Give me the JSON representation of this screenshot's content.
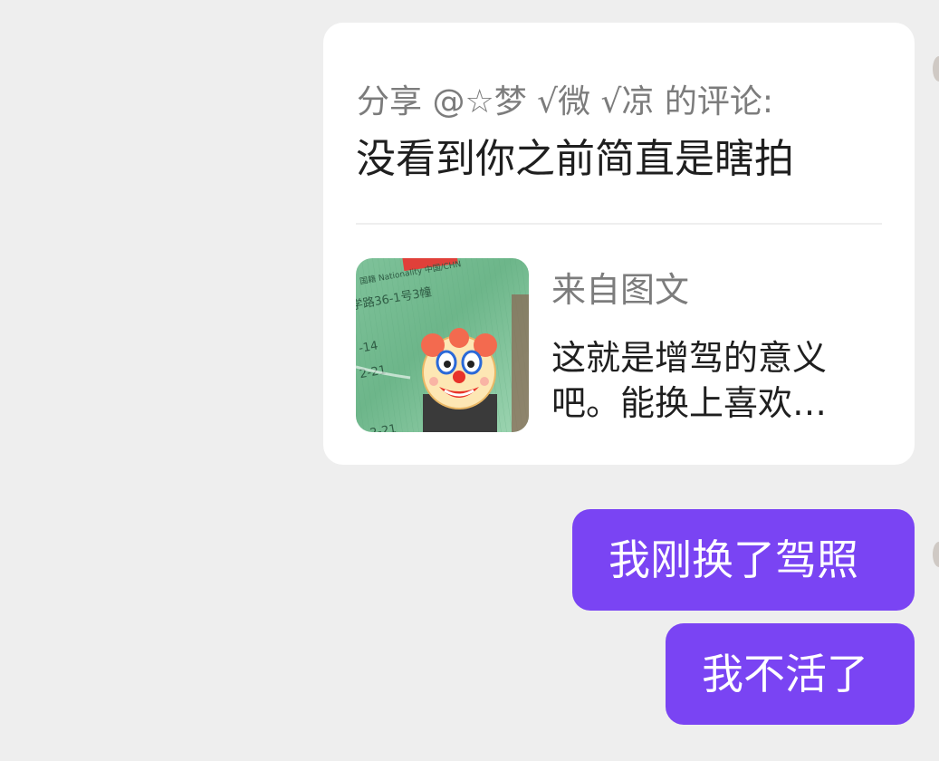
{
  "share_card": {
    "header": "分享 @☆梦 √微 √凉 的评论:",
    "comment": "没看到你之前简直是瞎拍",
    "source": {
      "label": "来自图文",
      "text": "这就是增驾的意义吧。能换上喜欢…",
      "thumbnail_labels": {
        "nationality": "国籍 Nationality 中国/CHN",
        "address": "学路36-1号3幢",
        "date_1": "-14",
        "date_2": "2-21",
        "date_3": "2-21"
      }
    }
  },
  "messages": [
    {
      "text": "我刚换了驾照"
    },
    {
      "text": "我不活了"
    }
  ],
  "colors": {
    "background": "#eeeeee",
    "card": "#ffffff",
    "bubble": "#7a44f3",
    "bubble_text": "#ffffff",
    "muted_text": "#7c7c7c",
    "body_text": "#1f1f1f"
  },
  "icons": {
    "thumbnail_overlay": "clown-face-emoji"
  }
}
